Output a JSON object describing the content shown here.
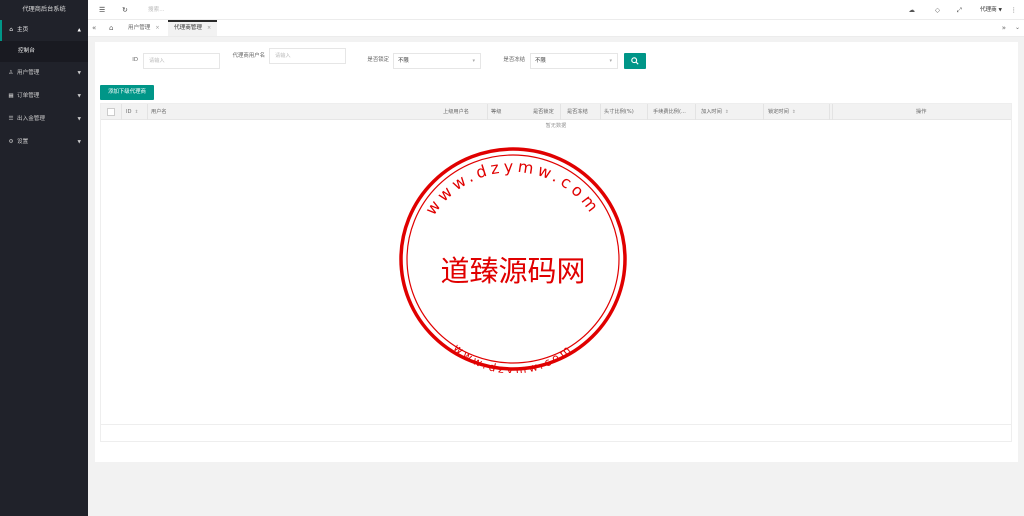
{
  "sidebar": {
    "brand": "代理商后台系统",
    "menu": [
      {
        "label": "主页",
        "icon": "home-icon",
        "open": true
      },
      {
        "label": "用户管理",
        "icon": "user-icon"
      },
      {
        "label": "订单管理",
        "icon": "grid-icon"
      },
      {
        "label": "出入金管理",
        "icon": "list-icon"
      },
      {
        "label": "设置",
        "icon": "gear-icon"
      }
    ],
    "submenu_label": "控制台"
  },
  "topbar": {
    "search_placeholder": "搜索...",
    "user_label": "代理商"
  },
  "tabs": {
    "items": [
      {
        "label": "用户管理",
        "active": false
      },
      {
        "label": "代理商管理",
        "active": true
      }
    ]
  },
  "filters": {
    "id_label": "ID",
    "id_placeholder": "请输入",
    "username_label": "代理商用户名",
    "username_placeholder": "请输入",
    "locked_label": "是否锁定",
    "locked_value": "不限",
    "frozen_label": "是否冻结",
    "frozen_value": "不限"
  },
  "toolbar": {
    "add_label": "添加下级代理商"
  },
  "table": {
    "columns": [
      "ID",
      "用户名",
      "上级用户名",
      "等级",
      "是否锁定",
      "是否冻结",
      "头寸比例(%)",
      "手续费比例(...",
      "加入时间",
      "锁定时间",
      "操作"
    ],
    "empty_text": "暂无数据"
  },
  "watermark": {
    "center_text": "道臻源码网",
    "top_arc": "www.dzymw.com",
    "bottom_arc": "www.dzymw.com",
    "color": "#e00000"
  },
  "colors": {
    "accent": "#009688",
    "sidebar_bg": "#20222a"
  }
}
